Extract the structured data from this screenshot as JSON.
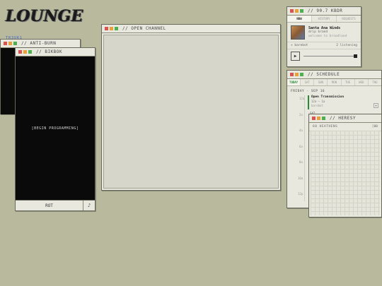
{
  "logo": {
    "text": "LOUNGE"
  },
  "side_label": "TR3UK1",
  "anti_burn": {
    "title": "// ANTI-BURN"
  },
  "bikbok": {
    "title": "// BIKBOK",
    "message": "[BEGIN PROGRAMMING]",
    "button_label": "ROT",
    "note_glyph": "♪"
  },
  "open_channel": {
    "title": "// OPEN CHANNEL"
  },
  "radio": {
    "title": "// 90.7 KBDR",
    "tabs": [
      "NOW",
      "HISTORY",
      "REQUESTS"
    ],
    "track": {
      "title": "Santa Ana Winds",
      "artist": "drip brand",
      "album": "welcome to broadland"
    },
    "dj": "+ barebot",
    "listeners": "2 listening",
    "play_glyph": "▶"
  },
  "schedule": {
    "title": "// SCHEDULE",
    "tabs": [
      "TODAY",
      "SAT",
      "SUN",
      "MON",
      "TUE",
      "WED",
      "THU"
    ],
    "date": "FRIDAY · SEP 16",
    "hours": [
      "12a",
      "2a",
      "4a",
      "6a",
      "8a",
      "10a",
      "12p"
    ],
    "first_show": {
      "name": "Open Transmission",
      "time": "12a – 1a",
      "host": "barebot"
    },
    "row_markers": [
      "SAT",
      "4",
      "A",
      "A",
      "6",
      "A",
      "6"
    ]
  },
  "heresy": {
    "title": "// HERESY",
    "subtitle": "60 HEATHENS",
    "aux": "[00"
  },
  "colors": {
    "background": "#b9b99d",
    "window": "#e9e8df",
    "close": "#d9534f",
    "min": "#e6a13b",
    "max": "#4caf50",
    "accent": "#3a66c8"
  }
}
